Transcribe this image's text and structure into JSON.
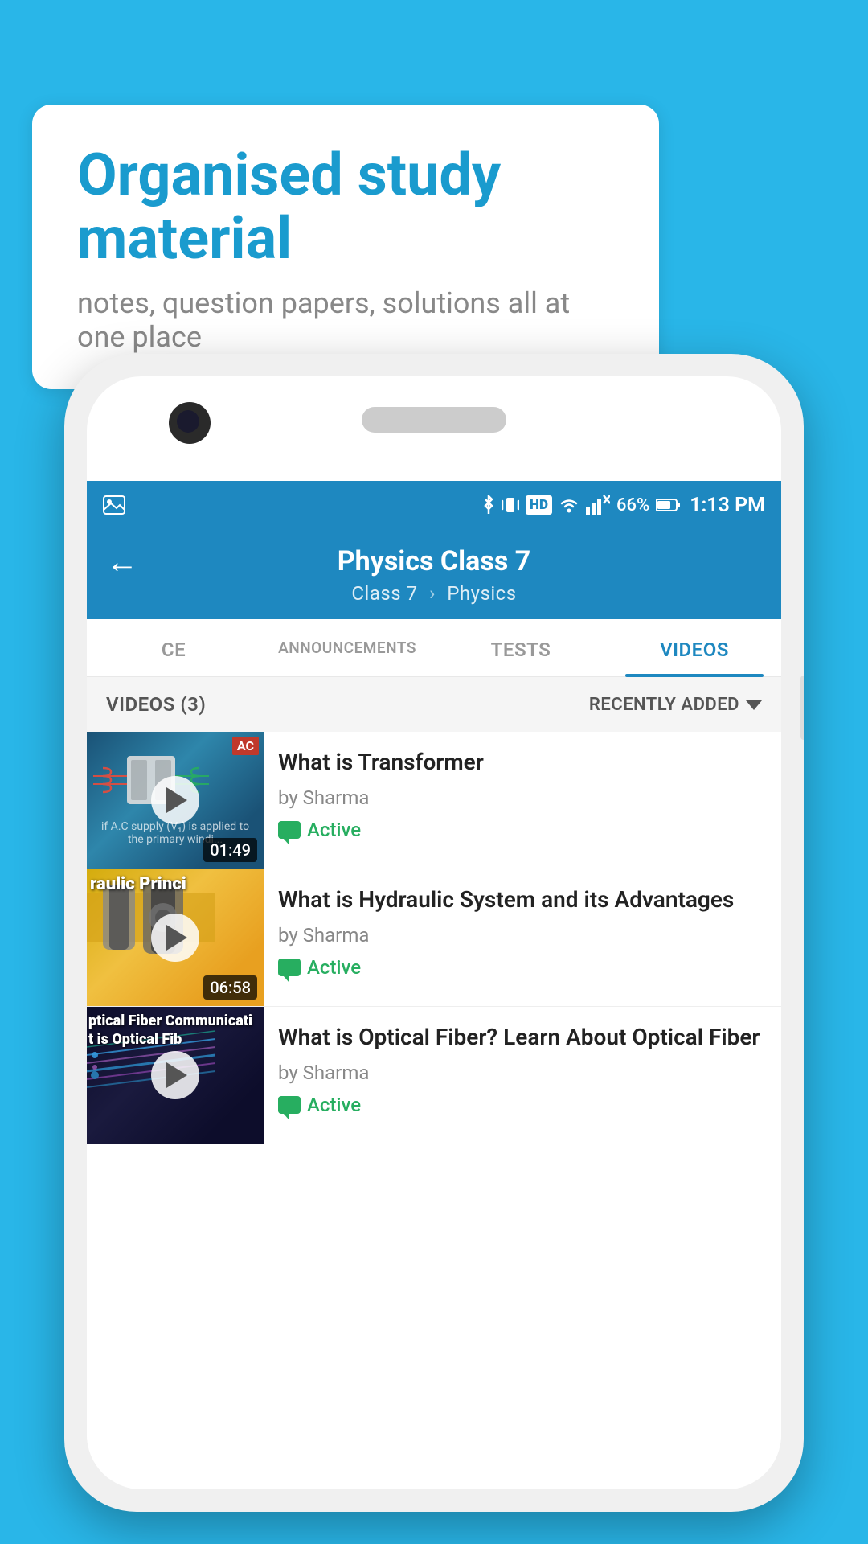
{
  "background": {
    "color": "#29b6e8"
  },
  "speech_bubble": {
    "title": "Organised study material",
    "subtitle": "notes, question papers, solutions all at one place"
  },
  "status_bar": {
    "bluetooth": "⚡",
    "signal": "HD",
    "wifi": "▲",
    "battery_percent": "66%",
    "time": "1:13 PM"
  },
  "app_header": {
    "back_label": "←",
    "title": "Physics Class 7",
    "breadcrumb1": "Class 7",
    "breadcrumb2": "Physics"
  },
  "tabs": [
    {
      "id": "ce",
      "label": "CE",
      "active": false
    },
    {
      "id": "announcements",
      "label": "ANNOUNCEMENTS",
      "active": false
    },
    {
      "id": "tests",
      "label": "TESTS",
      "active": false
    },
    {
      "id": "videos",
      "label": "VIDEOS",
      "active": true
    }
  ],
  "videos_header": {
    "count_label": "VIDEOS (3)",
    "sort_label": "RECENTLY ADDED"
  },
  "videos": [
    {
      "id": 1,
      "title": "What is  Transformer",
      "author": "by Sharma",
      "status": "Active",
      "duration": "01:49",
      "thumb_type": "transformer",
      "thumb_overlay": "if A.C supply (V₁) is applied to the primary windi...",
      "ac_badge": "AC"
    },
    {
      "id": 2,
      "title": "What is Hydraulic System and its Advantages",
      "author": "by Sharma",
      "status": "Active",
      "duration": "06:58",
      "thumb_type": "hydraulic",
      "thumb_overlay": "raulic Princi"
    },
    {
      "id": 3,
      "title": "What is Optical Fiber? Learn About Optical Fiber",
      "author": "by Sharma",
      "status": "Active",
      "duration": "",
      "thumb_type": "optical",
      "thumb_overlay": "ptical Fiber Communicati",
      "thumb_line2": "t is Optical Fib"
    }
  ]
}
